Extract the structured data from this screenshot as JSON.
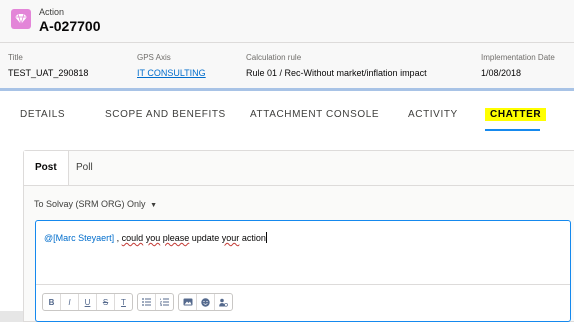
{
  "record": {
    "object_type": "Action",
    "name": "A-027700",
    "icon": "diamond-icon"
  },
  "fields": [
    {
      "label": "Title",
      "value": "TEST_UAT_290818"
    },
    {
      "label": "GPS Axis",
      "value": "IT CONSULTING"
    },
    {
      "label": "Calculation rule",
      "value": "Rule 01 / Rec-Without market/inflation impact"
    },
    {
      "label": "Implementation Date",
      "value": "1/08/2018"
    }
  ],
  "tabs": [
    "DETAILS",
    "SCOPE AND BENEFITS",
    "ATTACHMENT CONSOLE",
    "ACTIVITY",
    "CHATTER"
  ],
  "active_tab": "CHATTER",
  "publisher": {
    "tabs": [
      "Post",
      "Poll"
    ],
    "active": "Post",
    "to_label": "To",
    "audience": "Solvay (SRM ORG) Only",
    "mention": "@[Marc Steyaert]",
    "message_words": [
      {
        "t": " , ",
        "sq": false
      },
      {
        "t": "could",
        "sq": true
      },
      {
        "t": " ",
        "sq": false
      },
      {
        "t": "you",
        "sq": true
      },
      {
        "t": " ",
        "sq": false
      },
      {
        "t": "please",
        "sq": true
      },
      {
        "t": " update ",
        "sq": false
      },
      {
        "t": "your",
        "sq": true
      },
      {
        "t": " action",
        "sq": false
      }
    ],
    "toolbar": {
      "bold": "B",
      "italic": "I",
      "underline": "U",
      "strike": "S",
      "clear_format": "T"
    }
  },
  "colors": {
    "record_icon": "#e385d8",
    "link": "#006dcc",
    "active_tab_highlight": "#ffff00",
    "focus_border": "#1589ee"
  }
}
